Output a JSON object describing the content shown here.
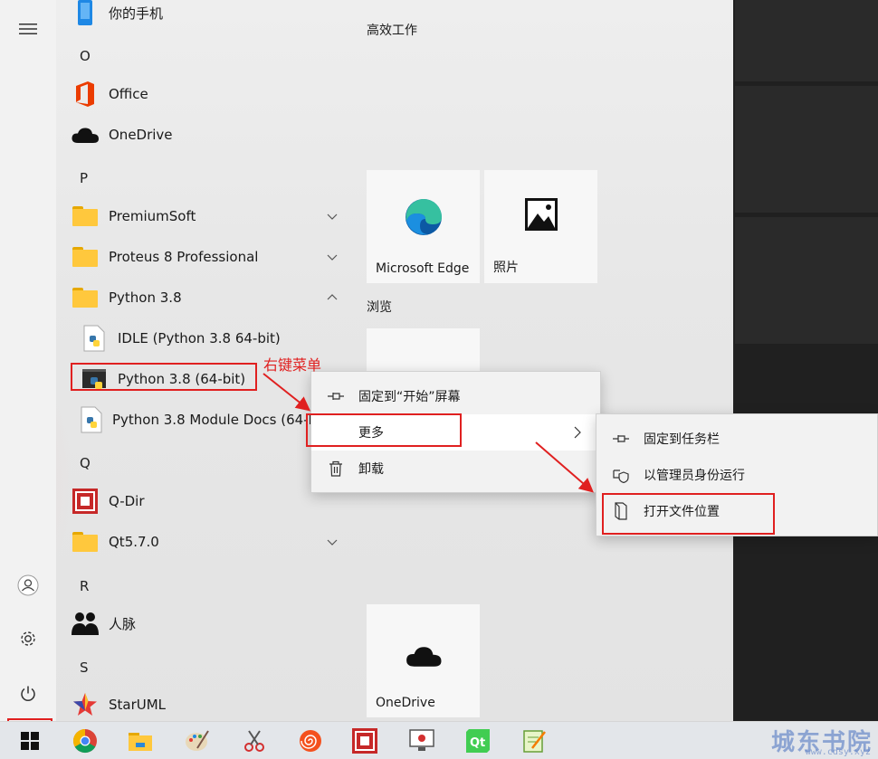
{
  "app_list": {
    "top_item": "你的手机",
    "letters": {
      "o": "O",
      "p": "P",
      "q": "Q",
      "r": "R",
      "s": "S"
    },
    "items": {
      "office": "Office",
      "onedrive": "OneDrive",
      "premiumsoft": "PremiumSoft",
      "proteus": "Proteus 8 Professional",
      "python_folder": "Python 3.8",
      "idle": "IDLE (Python 3.8 64-bit)",
      "python": "Python 3.8 (64-bit)",
      "module_docs": "Python 3.8 Module Docs (64-bit)",
      "qdir": "Q-Dir",
      "qt": "Qt5.7.0",
      "people": "人脉",
      "staruml": "StarUML"
    }
  },
  "tiles": {
    "group1_title": "高效工作",
    "group2_title": "浏览",
    "edge": "Microsoft Edge",
    "photos": "照片",
    "onedrive": "OneDrive"
  },
  "context_menu": {
    "pin_start": "固定到“开始”屏幕",
    "more": "更多",
    "uninstall": "卸载"
  },
  "submenu": {
    "pin_taskbar": "固定到任务栏",
    "run_admin": "以管理员身份运行",
    "open_location": "打开文件位置"
  },
  "annotation": "右键菜单",
  "watermark": {
    "text": "城东书院",
    "url": "www.cdsy.xyz"
  },
  "colors": {
    "annotation_red": "#e02020",
    "folder_yellow": "#ffc83d",
    "taskbar": "#e3e6ea"
  }
}
